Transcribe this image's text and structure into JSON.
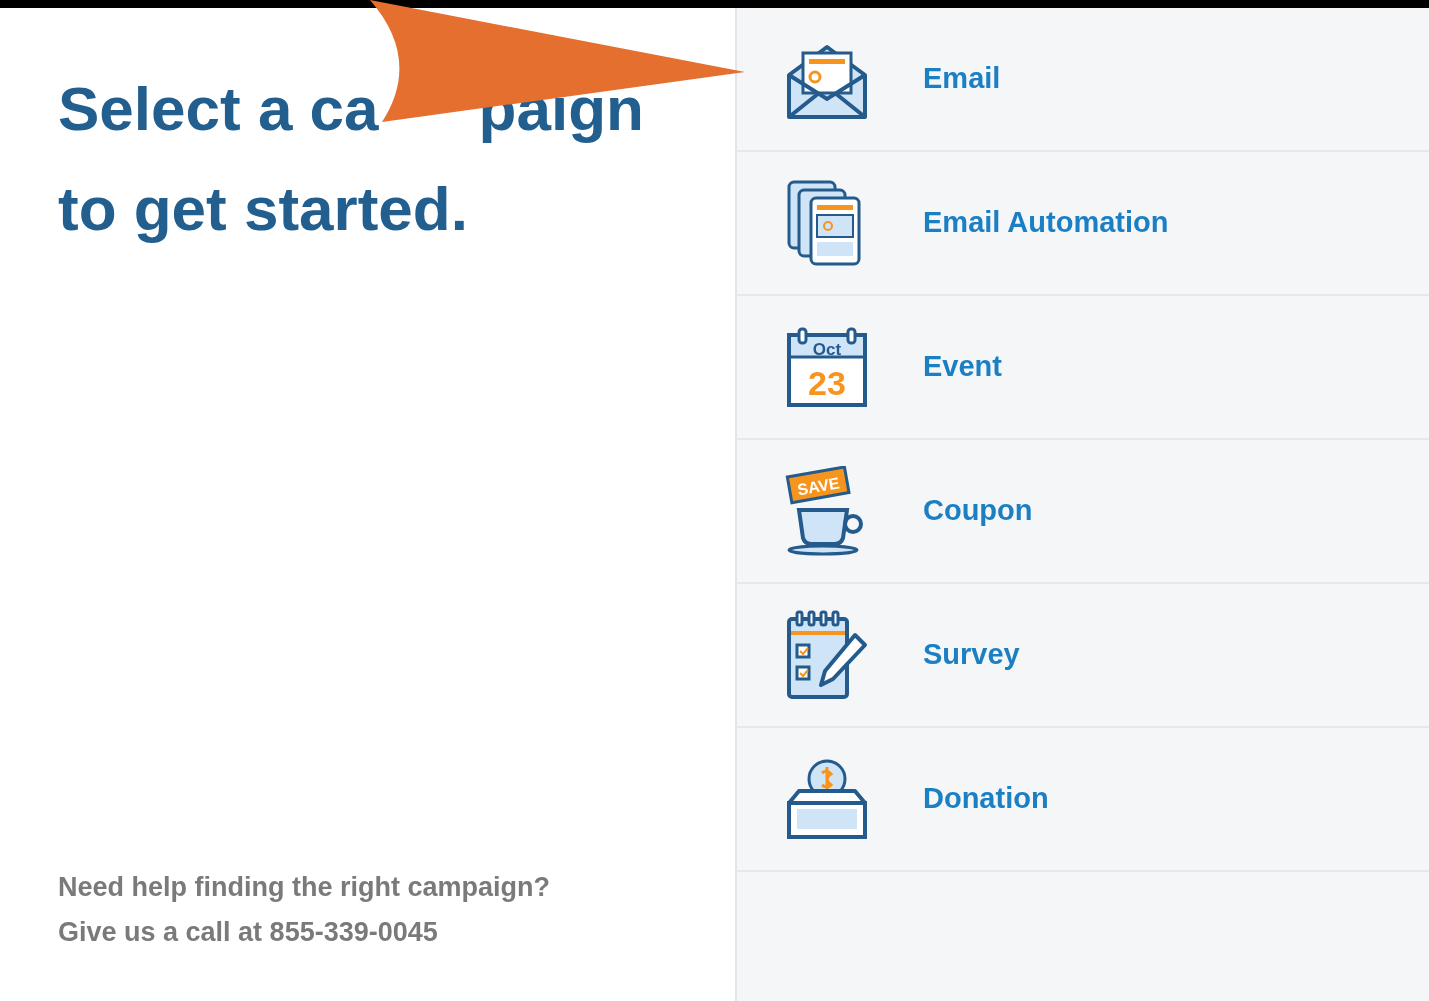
{
  "heading": {
    "line_1_start": "Select a ca",
    "line_1_end": "paign",
    "line_2": "to get started."
  },
  "help": {
    "line_1": "Need help finding the right campaign?",
    "line_2": "Give us a call at 855-339-0045"
  },
  "campaigns": [
    {
      "kind": "email",
      "label": "Email"
    },
    {
      "kind": "automation",
      "label": "Email Automation"
    },
    {
      "kind": "event",
      "label": "Event",
      "icon_month": "Oct",
      "icon_day": "23"
    },
    {
      "kind": "coupon",
      "label": "Coupon",
      "icon_tag": "SAVE"
    },
    {
      "kind": "survey",
      "label": "Survey"
    },
    {
      "kind": "donation",
      "label": "Donation"
    }
  ]
}
